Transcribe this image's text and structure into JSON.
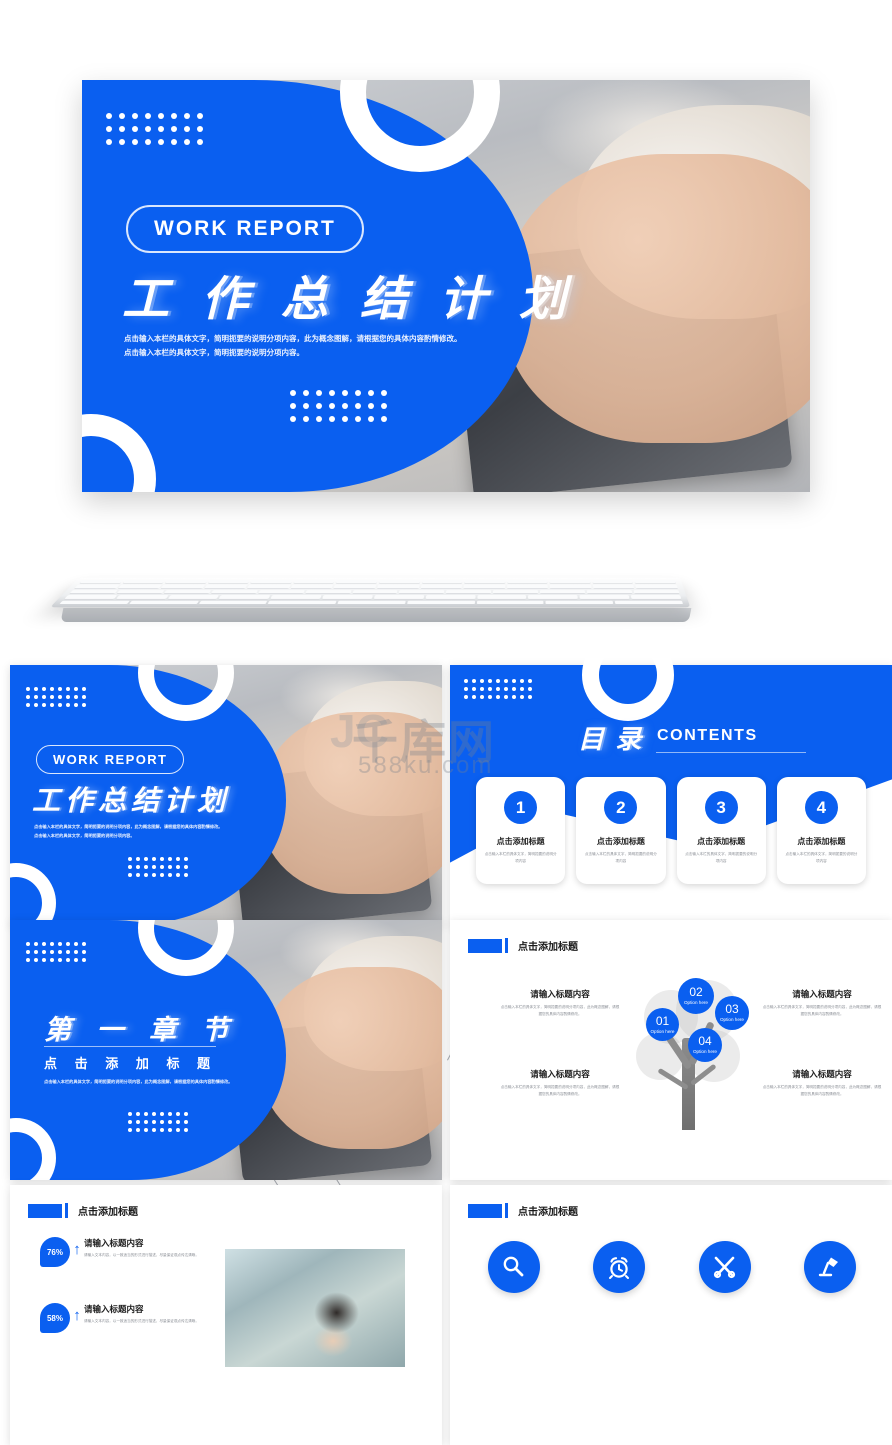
{
  "brand": {
    "blue": "#0a5ff0",
    "blue_dark": "#0550d8",
    "text_dark": "#1d1d1d",
    "text_muted": "#8b8f96"
  },
  "hero": {
    "badge": "WORK  REPORT",
    "title_cn": "工 作 总 结 计 划",
    "subtitle_line1": "点击输入本栏的具体文字，简明扼要的说明分项内容，此为概念图解，请根据您的具体内容酌情修改。",
    "subtitle_line2": "点击输入本栏的具体文字，简明扼要的说明分项内容。"
  },
  "devices": {
    "keyboard": "keyboard-mockup",
    "mouse": "mouse-mockup"
  },
  "slides": {
    "cover": {
      "badge": "WORK  REPORT",
      "title_cn": "工作总结计划",
      "subtitle_line1": "点击输入本栏的具体文字，简明扼要的说明分项内容，此为概念图解，请根据您的具体内容酌情修改。",
      "subtitle_line2": "点击输入本栏的具体文字，简明扼要的说明分项内容。"
    },
    "contents": {
      "title_cn": "目 录",
      "title_en": "CONTENTS",
      "cards": [
        {
          "num": "1",
          "title": "点击添加标题",
          "body": "点击输入本栏的具体文字，简明扼要的说明分项内容"
        },
        {
          "num": "2",
          "title": "点击添加标题",
          "body": "点击输入本栏的具体文字，简明扼要的说明分项内容"
        },
        {
          "num": "3",
          "title": "点击添加标题",
          "body": "点击输入本栏的具体文字，简明扼要的说明分项内容"
        },
        {
          "num": "4",
          "title": "点击添加标题",
          "body": "点击输入本栏的具体文字，简明扼要的说明分项内容"
        }
      ]
    },
    "chapter": {
      "title_cn": "第 一 章 节",
      "subtitle_cn": "点 击 添 加 标 题",
      "desc": "点击输入本栏的具体文字，简明扼要的说明分项内容，此为概念图解，请根据您的具体内容酌情修改。"
    },
    "tree": {
      "header": "点击添加标题",
      "circles": [
        {
          "num": "01",
          "caption": "Option here"
        },
        {
          "num": "02",
          "caption": "Option here"
        },
        {
          "num": "03",
          "caption": "Option here"
        },
        {
          "num": "04",
          "caption": "Option here"
        }
      ],
      "columns": [
        {
          "title": "请输入标题内容",
          "body": "点击输入本栏的具体文字，简明扼要的说明分项内容，此为概念图解，请根据您的具体内容酌情修改。"
        },
        {
          "title": "请输入标题内容",
          "body": "点击输入本栏的具体文字，简明扼要的说明分项内容，此为概念图解，请根据您的具体内容酌情修改。"
        },
        {
          "title": "请输入标题内容",
          "body": "点击输入本栏的具体文字，简明扼要的说明分项内容，此为概念图解，请根据您的具体内容酌情修改。"
        },
        {
          "title": "请输入标题内容",
          "body": "点击输入本栏的具体文字，简明扼要的说明分项内容，此为概念图解，请根据您的具体内容酌情修改。"
        }
      ]
    },
    "stats": {
      "header": "点击添加标题",
      "rows": [
        {
          "percent": "76%",
          "arrow": "↑",
          "title": "请输入标题内容",
          "body": "请输入文本内容，以一致适当的形式进行描述，尽量保证观点传达清晰。"
        },
        {
          "percent": "58%",
          "arrow": "↑",
          "title": "请输入标题内容",
          "body": "请输入文本内容，以一致适当的形式进行描述，尽量保证观点传达清晰。"
        }
      ]
    },
    "icons": {
      "header": "点击添加标题",
      "items": [
        {
          "icon": "search-icon"
        },
        {
          "icon": "alarm-clock-icon"
        },
        {
          "icon": "tools-icon"
        },
        {
          "icon": "desk-lamp-icon"
        }
      ]
    }
  },
  "watermark": {
    "cn": "千库网",
    "url": "588ku.com",
    "logo": "JC"
  }
}
